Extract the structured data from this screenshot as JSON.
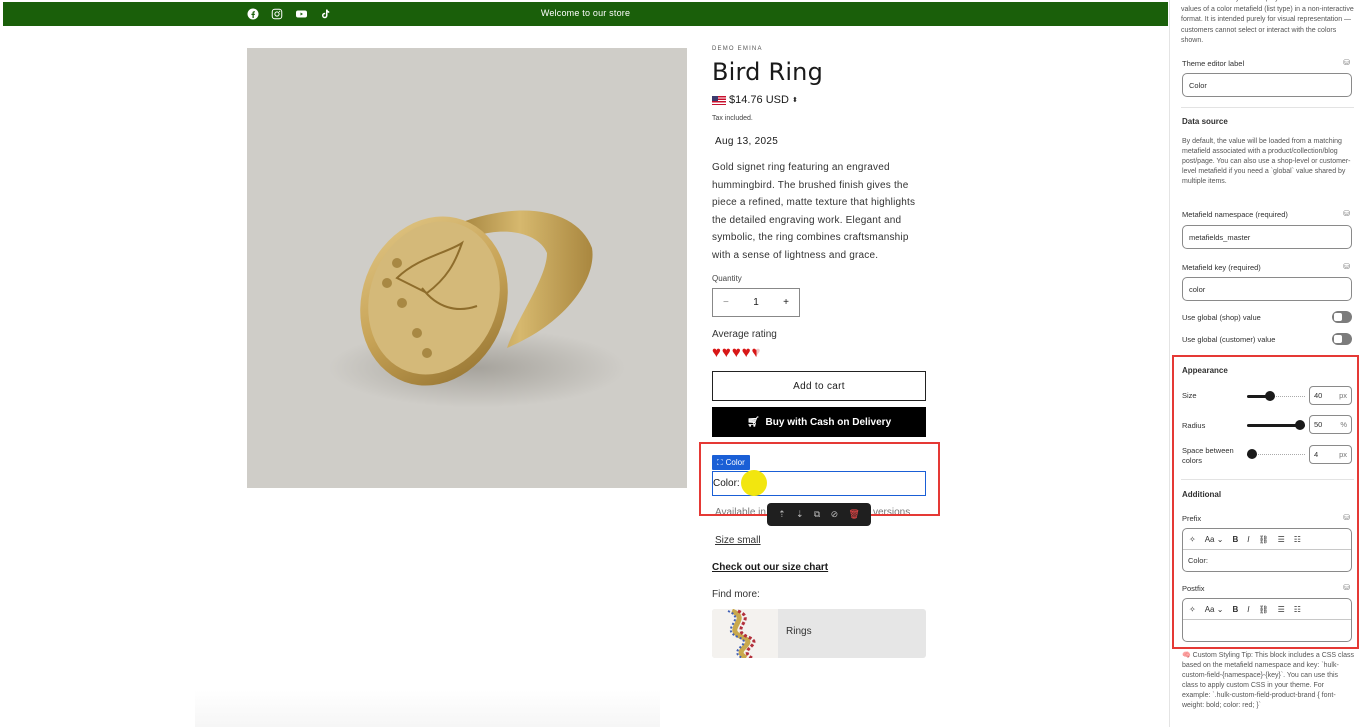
{
  "announcement": {
    "message": "Welcome to our store",
    "social_icons": [
      "facebook-icon",
      "instagram-icon",
      "youtube-icon",
      "tiktok-icon"
    ],
    "bg_color": "#1a5f0a"
  },
  "product": {
    "vendor": "DEMO EMINA",
    "title": "Bird Ring",
    "price": "$14.76 USD",
    "tax_note": "Tax included.",
    "date": "Aug 13, 2025",
    "description": "Gold signet ring featuring an engraved hummingbird. The brushed finish gives the piece a refined, matte texture that highlights the detailed engraving work. Elegant and symbolic, the ring combines craftsmanship with a sense of lightness and grace.",
    "quantity_label": "Quantity",
    "quantity_value": "1",
    "minus": "−",
    "plus": "+",
    "rating_label": "Average rating",
    "rating": 4.5,
    "rating_max": 5,
    "add_to_cart": "Add to cart",
    "buy_cash": "Buy with Cash on Delivery",
    "color_badge": "Color",
    "color_text": "Color:",
    "color_swatch": "#f2e60f",
    "available_left": "Available in",
    "available_right": "versions",
    "size_small": "Size small",
    "size_chart": "Check out our size chart",
    "find_more": "Find more:",
    "collection_card": "Rings"
  },
  "sidebar": {
    "intro": "This block allows you to display colors based on the values of a color metafield (list type) in a non-interactive format. It is intended purely for visual representation — customers cannot select or interact with the colors shown.",
    "theme_label_title": "Theme editor label",
    "theme_label_value": "Color",
    "data_source_title": "Data source",
    "data_source_help": "By default, the value will be loaded from a matching metafield associated with a product/collection/blog post/page. You can also use a shop-level or customer-level metafield if you need a `global` value shared by multiple items.",
    "namespace_label": "Metafield namespace (required)",
    "namespace_value": "metafields_master",
    "key_label": "Metafield key (required)",
    "key_value": "color",
    "global_shop_label": "Use global (shop) value",
    "global_customer_label": "Use global (customer) value",
    "appearance_title": "Appearance",
    "size_label": "Size",
    "size_value": "40",
    "size_unit": "px",
    "size_fraction": 0.4,
    "radius_label": "Radius",
    "radius_value": "50",
    "radius_unit": "%",
    "radius_fraction": 1.0,
    "space_label": "Space between colors",
    "space_value": "4",
    "space_unit": "px",
    "space_fraction": 0.05,
    "additional_title": "Additional",
    "prefix_label": "Prefix",
    "prefix_value": "Color:",
    "postfix_label": "Postfix",
    "postfix_value": "",
    "rte_format": "Aa",
    "rte_bold": "B",
    "rte_italic": "I",
    "tip": "🧠 Custom Styling Tip: This block includes a CSS class based on the metafield namespace and key: `hulk-custom-field-{namespace}-{key}`. You can use this class to apply custom CSS in your theme. For example: `.hulk-custom-field-product-brand { font-weight: bold; color: red; }`"
  },
  "colors": {
    "highlight_red": "#e53935",
    "selection_blue": "#1a5fd6"
  }
}
